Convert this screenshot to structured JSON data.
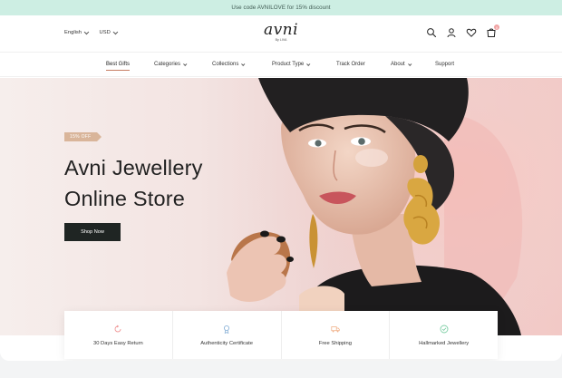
{
  "announcement": "Use code AVNILOVE for 15% discount",
  "header": {
    "language": "English",
    "currency": "USD",
    "logo": {
      "word": "avni",
      "sub": "By LIVA"
    },
    "cart_count": "0"
  },
  "nav": [
    {
      "label": "Best Gifts",
      "has_menu": false
    },
    {
      "label": "Categories",
      "has_menu": true
    },
    {
      "label": "Collections",
      "has_menu": true
    },
    {
      "label": "Product Type",
      "has_menu": true
    },
    {
      "label": "Track Order",
      "has_menu": false
    },
    {
      "label": "About",
      "has_menu": true
    },
    {
      "label": "Support",
      "has_menu": false
    }
  ],
  "hero": {
    "badge": "15% OFF",
    "title_line1": "Avni Jewellery",
    "title_line2": "Online Store",
    "cta": "Shop Now"
  },
  "features": [
    {
      "label": "30 Days Easy Return",
      "icon": "return-icon",
      "color": "#f19a9a"
    },
    {
      "label": "Authenticity Certificate",
      "icon": "certificate-icon",
      "color": "#8fb5d9"
    },
    {
      "label": "Free Shipping",
      "icon": "truck-icon",
      "color": "#f1b28a"
    },
    {
      "label": "Hallmarked Jewellery",
      "icon": "check-badge-icon",
      "color": "#7fcfa6"
    }
  ],
  "colors": {
    "accent": "#c77d63",
    "announcement_bg": "#cdeee3",
    "cta_bg": "#1f2523",
    "badge_bg": "#d9b59a"
  }
}
